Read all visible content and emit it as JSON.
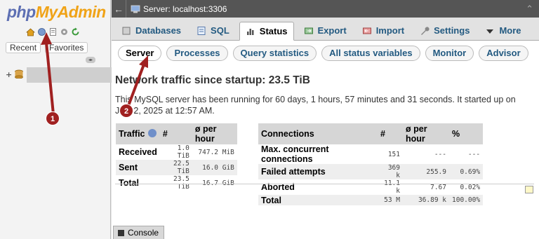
{
  "nav": {
    "logo_php": "php",
    "logo_admin": "MyAdmin",
    "tabs": [
      "Recent",
      "Favorites"
    ],
    "icons": [
      "home-icon",
      "logout-icon",
      "docs-icon",
      "settings-icon",
      "reload-icon"
    ]
  },
  "topbar": {
    "breadcrumb": "Server: localhost:3306"
  },
  "menu": [
    {
      "label": "Databases",
      "icon": "database-icon",
      "active": false
    },
    {
      "label": "SQL",
      "icon": "sql-icon",
      "active": false
    },
    {
      "label": "Status",
      "icon": "status-icon",
      "active": true
    },
    {
      "label": "Export",
      "icon": "export-icon",
      "active": false
    },
    {
      "label": "Import",
      "icon": "import-icon",
      "active": false
    },
    {
      "label": "Settings",
      "icon": "wrench-icon",
      "active": false
    },
    {
      "label": "More",
      "icon": "caret-down-icon",
      "active": false
    }
  ],
  "subtabs": [
    {
      "label": "Server",
      "active": true
    },
    {
      "label": "Processes",
      "active": false
    },
    {
      "label": "Query statistics",
      "active": false
    },
    {
      "label": "All status variables",
      "active": false
    },
    {
      "label": "Monitor",
      "active": false
    },
    {
      "label": "Advisor",
      "active": false
    }
  ],
  "heading": "Network traffic since startup: 23.5 TiB",
  "uptime": "This MySQL server has been running for 60 days, 1 hours, 57 minutes and 31 seconds. It started up on Jul 02, 2025 at 12:57 AM.",
  "traffic": {
    "headers": [
      "Traffic",
      "#",
      "ø per hour"
    ],
    "rows": [
      [
        "Received",
        "1.0 TiB",
        "747.2 MiB"
      ],
      [
        "Sent",
        "22.5 TiB",
        "16.0 GiB"
      ],
      [
        "Total",
        "23.5 TiB",
        "16.7 GiB"
      ]
    ]
  },
  "connections": {
    "headers": [
      "Connections",
      "#",
      "ø per hour",
      "%"
    ],
    "rows": [
      [
        "Max. concurrent connections",
        "151",
        "---",
        "---"
      ],
      [
        "Failed attempts",
        "369 k",
        "255.9",
        "0.69%"
      ],
      [
        "Aborted",
        "11.1 k",
        "7.67",
        "0.02%"
      ],
      [
        "Total",
        "53 M",
        "36.89 k",
        "100.00%"
      ]
    ]
  },
  "console_label": "Console",
  "annotations": [
    {
      "number": "1",
      "color": "#a02020"
    },
    {
      "number": "2",
      "color": "#a02020"
    }
  ],
  "colors": {
    "link": "#235a81",
    "topbar": "#555555",
    "logo_php": "#5d6fb3",
    "logo_admin": "#f0a317",
    "annotation": "#a02020"
  }
}
